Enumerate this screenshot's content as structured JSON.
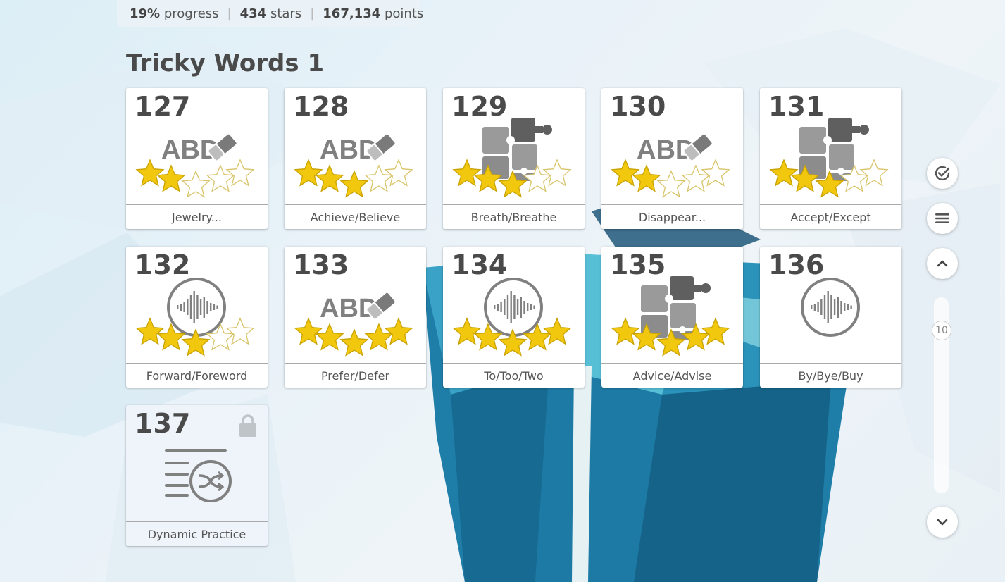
{
  "stats": {
    "progress_value": "19%",
    "progress_label": "progress",
    "stars_value": "434",
    "stars_label": "stars",
    "points_value": "167,134",
    "points_label": "points"
  },
  "section_title": "Tricky Words 1",
  "lessons": [
    {
      "number": "127",
      "label": "Jewelry...",
      "icon": "eraser-spelling-icon",
      "stars": 2,
      "locked": false
    },
    {
      "number": "128",
      "label": "Achieve/Believe",
      "icon": "eraser-spelling-icon",
      "stars": 3,
      "locked": false
    },
    {
      "number": "129",
      "label": "Breath/Breathe",
      "icon": "puzzle-icon",
      "stars": 3,
      "locked": false
    },
    {
      "number": "130",
      "label": "Disappear...",
      "icon": "eraser-spelling-icon",
      "stars": 2,
      "locked": false
    },
    {
      "number": "131",
      "label": "Accept/Except",
      "icon": "puzzle-icon",
      "stars": 3,
      "locked": false
    },
    {
      "number": "132",
      "label": "Forward/Foreword",
      "icon": "audio-wave-icon",
      "stars": 3,
      "locked": false
    },
    {
      "number": "133",
      "label": "Prefer/Defer",
      "icon": "eraser-spelling-icon",
      "stars": 5,
      "locked": false
    },
    {
      "number": "134",
      "label": "To/Too/Two",
      "icon": "audio-wave-icon",
      "stars": 5,
      "locked": false
    },
    {
      "number": "135",
      "label": "Advice/Advise",
      "icon": "puzzle-icon",
      "stars": 5,
      "locked": false
    },
    {
      "number": "136",
      "label": "By/Bye/Buy",
      "icon": "audio-wave-icon",
      "stars": 0,
      "locked": false
    },
    {
      "number": "137",
      "label": "Dynamic Practice",
      "icon": "shuffle-list-icon",
      "stars": 0,
      "locked": true
    }
  ],
  "icon_text": "ABD",
  "scroll": {
    "value": "10"
  },
  "colors": {
    "star_fill": "#f2c80f",
    "star_empty": "#ffffff",
    "icon_gray": "#808080",
    "text_dark": "#4a4a4a"
  }
}
